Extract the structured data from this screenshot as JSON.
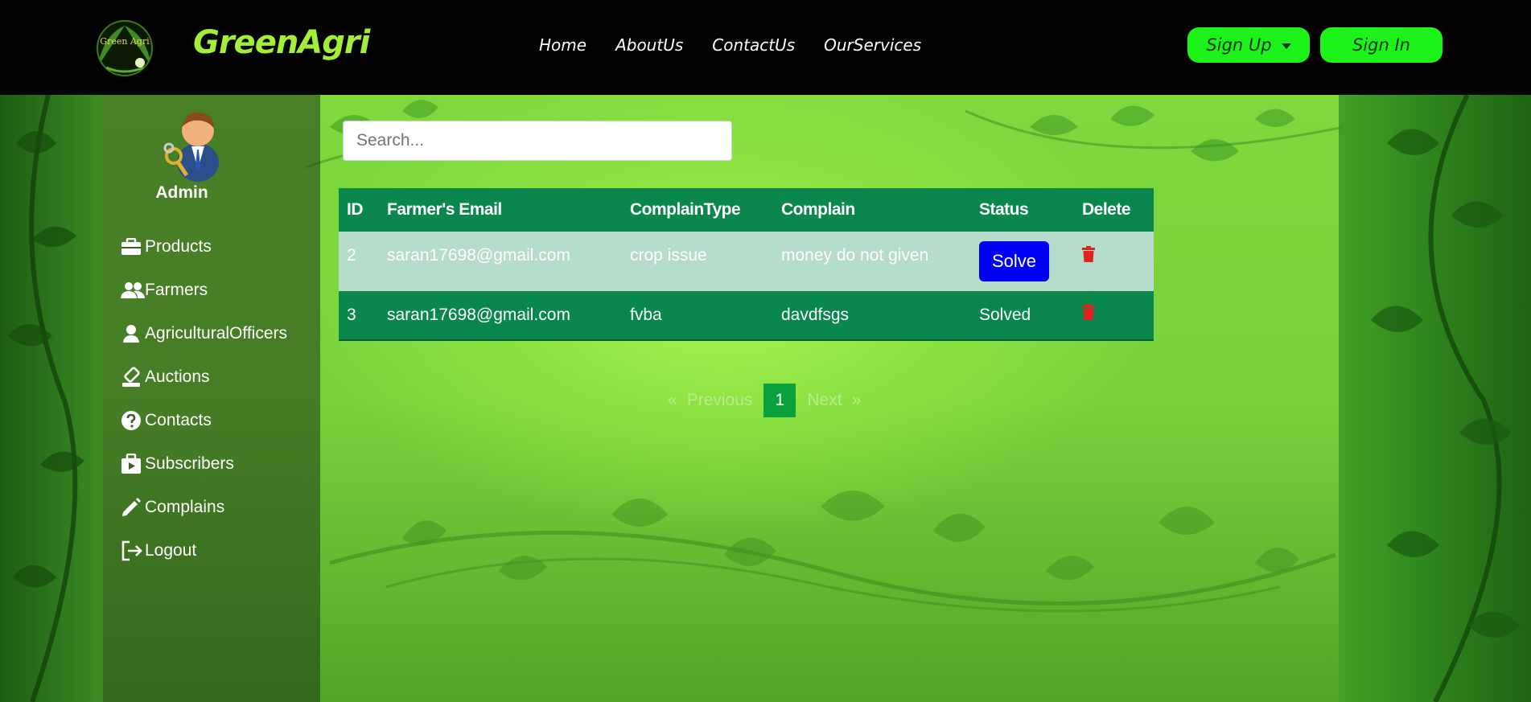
{
  "brand": {
    "name": "GreenAgri",
    "logo_text": "Green Agri"
  },
  "nav": {
    "links": [
      "Home",
      "AboutUs",
      "ContactUs",
      "OurServices"
    ],
    "signup_label": "Sign Up",
    "signin_label": "Sign In"
  },
  "sidebar": {
    "admin_label": "Admin",
    "items": [
      {
        "label": "Products",
        "icon": "briefcase-icon"
      },
      {
        "label": "Farmers",
        "icon": "users-icon"
      },
      {
        "label": "AgriculturalOfficers",
        "icon": "user-icon"
      },
      {
        "label": "Auctions",
        "icon": "gavel-icon"
      },
      {
        "label": "Contacts",
        "icon": "question-circle-icon"
      },
      {
        "label": "Subscribers",
        "icon": "subscribe-icon"
      },
      {
        "label": "Complains",
        "icon": "pencil-icon"
      },
      {
        "label": "Logout",
        "icon": "logout-icon"
      }
    ]
  },
  "search": {
    "placeholder": "Search...",
    "value": ""
  },
  "table": {
    "headers": [
      "ID",
      "Farmer's Email",
      "ComplainType",
      "Complain",
      "Status",
      "Delete"
    ],
    "rows": [
      {
        "id": "2",
        "email": "saran17698@gmail.com",
        "type": "crop issue",
        "complain": "money do not given",
        "status": "Solve",
        "status_is_button": true
      },
      {
        "id": "3",
        "email": "saran17698@gmail.com",
        "type": "fvba",
        "complain": "davdfsgs",
        "status": "Solved",
        "status_is_button": false
      }
    ]
  },
  "pagination": {
    "prev_arrow": "«",
    "prev_label": "Previous",
    "current_page": "1",
    "next_label": "Next",
    "next_arrow": "»"
  },
  "colors": {
    "navbar": "#020202",
    "brand": "#a4ee3a",
    "nav_button": "#1ef21b",
    "table_header": "#09874c",
    "row_light": "#b6dccb",
    "solve_button": "#0000f5",
    "trash": "#e0231c"
  }
}
